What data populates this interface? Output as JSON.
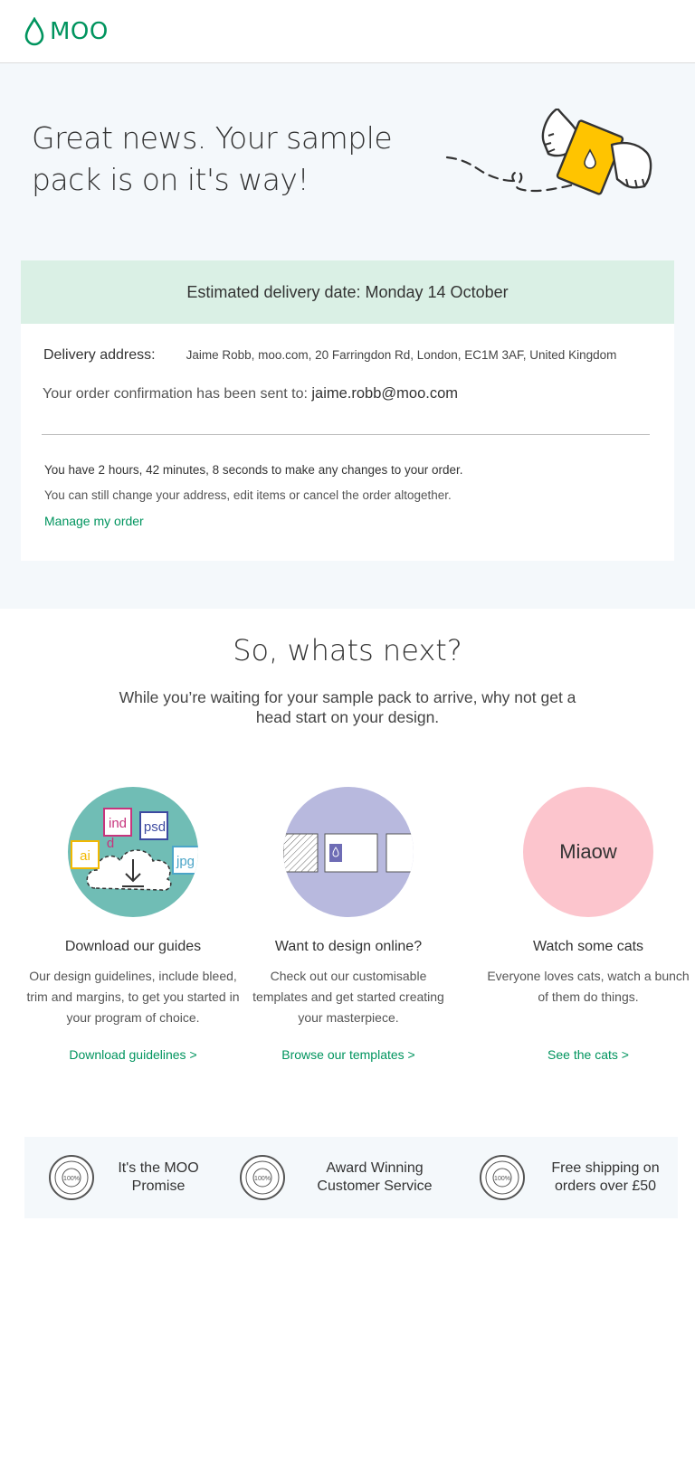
{
  "header": {
    "logo_text": "MOO"
  },
  "hero": {
    "title": "Great news. Your sample pack is on it's way!"
  },
  "delivery": {
    "estimated": "Estimated delivery date: Monday 14 October"
  },
  "order": {
    "address_label": "Delivery address:",
    "address_value": "Jaime Robb, moo.com, 20 Farringdon Rd, London, EC1M 3AF, United Kingdom",
    "confirmation_prefix": "Your order confirmation has been sent to:",
    "confirmation_email": "jaime.robb@moo.com",
    "timer_text": "You have 2 hours, 42 minutes, 8 seconds to make any changes to your order.",
    "change_note": "You can still change your address, edit items or cancel the order altogether.",
    "manage_link": "Manage my order"
  },
  "next": {
    "title": "So, whats next?",
    "subtitle": "While you’re waiting for your sample pack to arrive, why not get a head start on your design."
  },
  "features": [
    {
      "title": "Download our guides",
      "body": "Our design guidelines, include bleed, trim and margins, to get you started in your program of choice.",
      "link": "Download guidelines >",
      "file_tags": [
        "ind",
        "d",
        "psd",
        "ai",
        "jpg"
      ]
    },
    {
      "title": "Want to design online?",
      "body": "Check out our customisable templates and get started creating your masterpiece.",
      "link": "Browse our templates >"
    },
    {
      "title": "Watch some cats",
      "body": "Everyone loves cats, watch a bunch of them do things.",
      "link": "See the cats >",
      "circle_label": "Miaow"
    }
  ],
  "promise": {
    "badge_text": "100%",
    "badge_top": "SATISFACTION",
    "badge_bottom": "GUARANTEED",
    "items": [
      "It's the MOO Promise",
      "Award Winning Customer Service",
      "Free shipping on orders over £50"
    ]
  },
  "colors": {
    "brand_green": "#00945e",
    "hero_bg": "#f4f8fb",
    "delivery_bg": "#daf0e5",
    "teal": "#70bdb5",
    "lavender": "#b8b9de",
    "pink": "#fcc5cd",
    "yellow": "#ffc400"
  }
}
